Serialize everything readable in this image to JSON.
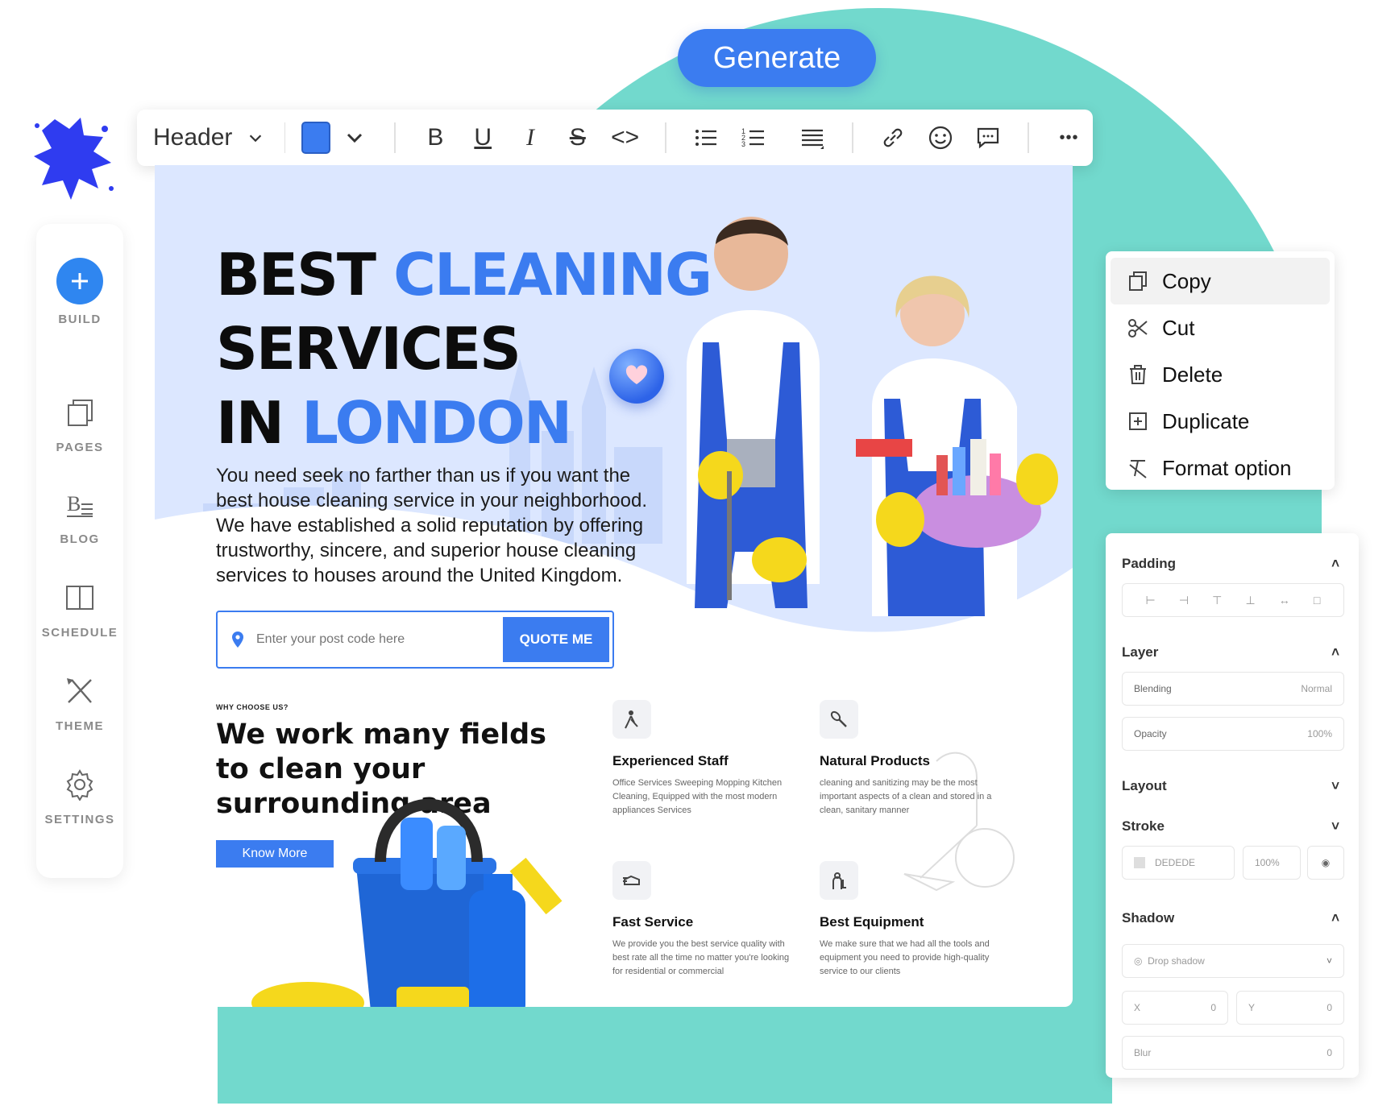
{
  "generate_label": "Generate",
  "toolbar": {
    "block_type": "Header",
    "color": "#3b7cf0",
    "buttons": [
      "bold-icon",
      "underline-icon",
      "italic-icon",
      "strikethrough-icon",
      "code-icon",
      "bullet-list-icon",
      "numbered-list-icon",
      "align-icon",
      "link-icon",
      "emoji-icon",
      "comment-icon",
      "more-icon"
    ],
    "bold": "B",
    "underline": "U",
    "italic": "I",
    "strike": "S",
    "code": "<>",
    "more": "•••"
  },
  "sidebar": {
    "items": [
      {
        "label": "BUILD",
        "icon": "plus-icon"
      },
      {
        "label": "PAGES",
        "icon": "pages-icon"
      },
      {
        "label": "BLOG",
        "icon": "blog-icon"
      },
      {
        "label": "SCHEDULE",
        "icon": "book-icon"
      },
      {
        "label": "THEME",
        "icon": "theme-icon"
      },
      {
        "label": "SETTINGS",
        "icon": "gear-icon"
      }
    ]
  },
  "site": {
    "hero": {
      "title_line1_a": "BEST ",
      "title_line1_b": "CLEANING",
      "title_line2": "SERVICES",
      "title_line3_a": "IN ",
      "title_line3_b": "LONDON",
      "text": "You need seek no farther than us if you want the best house cleaning service in your neighborhood. We have established a solid reputation by offering trustworthy, sincere, and superior house cleaning services to houses around the United Kingdom.",
      "postcode_placeholder": "Enter your post code here",
      "quote_label": "QUOTE ME"
    },
    "why": {
      "label": "WHY CHOOSE US?",
      "title": "We work many fields to clean your surrounding area",
      "button": "Know More"
    },
    "features": [
      {
        "title": "Experienced Staff",
        "desc": "Office Services Sweeping Mopping Kitchen Cleaning, Equipped with the most modern appliances Services",
        "icon": "cleaner-icon"
      },
      {
        "title": "Natural Products",
        "desc": "cleaning and sanitizing may be the most important aspects of a clean and stored in a clean, sanitary manner",
        "icon": "brush-icon"
      },
      {
        "title": "Fast Service",
        "desc": "We provide you the best service quality with best rate all the time no matter you're looking for residential or commercial",
        "icon": "fast-icon"
      },
      {
        "title": "Best Equipment",
        "desc": "We make sure that we had all the tools and equipment you need to provide high-quality service to our clients",
        "icon": "equipment-icon"
      }
    ]
  },
  "context_menu": {
    "items": [
      {
        "label": "Copy",
        "icon": "copy-icon"
      },
      {
        "label": "Cut",
        "icon": "scissors-icon"
      },
      {
        "label": "Delete",
        "icon": "trash-icon"
      },
      {
        "label": "Duplicate",
        "icon": "duplicate-icon"
      },
      {
        "label": "Format option",
        "icon": "clear-format-icon"
      }
    ]
  },
  "props": {
    "padding": "Padding",
    "layer": "Layer",
    "blending_label": "Blending",
    "blending_value": "Normal",
    "opacity_label": "Opacity",
    "opacity_value": "100%",
    "layout": "Layout",
    "stroke": "Stroke",
    "stroke_color": "DEDEDE",
    "stroke_opacity": "100%",
    "shadow": "Shadow",
    "shadow_type": "Drop shadow",
    "x_label": "X",
    "x_value": "0",
    "y_label": "Y",
    "y_value": "0",
    "blur_label": "Blur",
    "blur_value": "0"
  }
}
